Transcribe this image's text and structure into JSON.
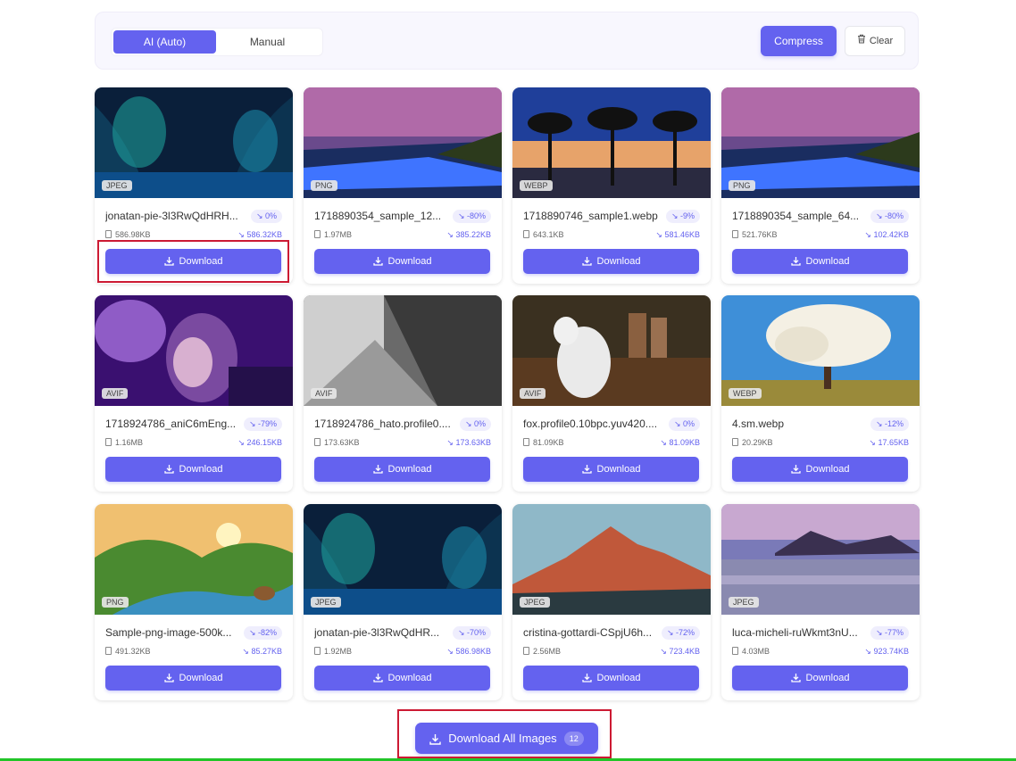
{
  "toolbar": {
    "mode_auto": "AI (Auto)",
    "mode_manual": "Manual",
    "compress": "Compress",
    "clear": "Clear"
  },
  "colors": {
    "accent": "#6462ef",
    "highlight": "#cc1a33",
    "status_bar": "#22c528"
  },
  "download_label": "Download",
  "images": [
    {
      "name": "jonatan-pie-3l3RwQdHRH...",
      "format": "JPEG",
      "saving": "0%",
      "original": "586.98KB",
      "compressed": "586.32KB"
    },
    {
      "name": "1718890354_sample_12...",
      "format": "PNG",
      "saving": "-80%",
      "original": "1.97MB",
      "compressed": "385.22KB"
    },
    {
      "name": "1718890746_sample1.webp",
      "format": "WEBP",
      "saving": "-9%",
      "original": "643.1KB",
      "compressed": "581.46KB"
    },
    {
      "name": "1718890354_sample_64...",
      "format": "PNG",
      "saving": "-80%",
      "original": "521.76KB",
      "compressed": "102.42KB"
    },
    {
      "name": "1718924786_aniC6mEng...",
      "format": "AVIF",
      "saving": "-79%",
      "original": "1.16MB",
      "compressed": "246.15KB"
    },
    {
      "name": "1718924786_hato.profile0....",
      "format": "AVIF",
      "saving": "0%",
      "original": "173.63KB",
      "compressed": "173.63KB"
    },
    {
      "name": "fox.profile0.10bpc.yuv420....",
      "format": "AVIF",
      "saving": "0%",
      "original": "81.09KB",
      "compressed": "81.09KB"
    },
    {
      "name": "4.sm.webp",
      "format": "WEBP",
      "saving": "-12%",
      "original": "20.29KB",
      "compressed": "17.65KB"
    },
    {
      "name": "Sample-png-image-500k...",
      "format": "PNG",
      "saving": "-82%",
      "original": "491.32KB",
      "compressed": "85.27KB"
    },
    {
      "name": "jonatan-pie-3l3RwQdHR...",
      "format": "JPEG",
      "saving": "-70%",
      "original": "1.92MB",
      "compressed": "586.98KB"
    },
    {
      "name": "cristina-gottardi-CSpjU6h...",
      "format": "JPEG",
      "saving": "-72%",
      "original": "2.56MB",
      "compressed": "723.4KB"
    },
    {
      "name": "luca-micheli-ruWkmt3nU...",
      "format": "JPEG",
      "saving": "-77%",
      "original": "4.03MB",
      "compressed": "923.74KB"
    }
  ],
  "download_all": {
    "label": "Download All Images",
    "count": "12"
  }
}
